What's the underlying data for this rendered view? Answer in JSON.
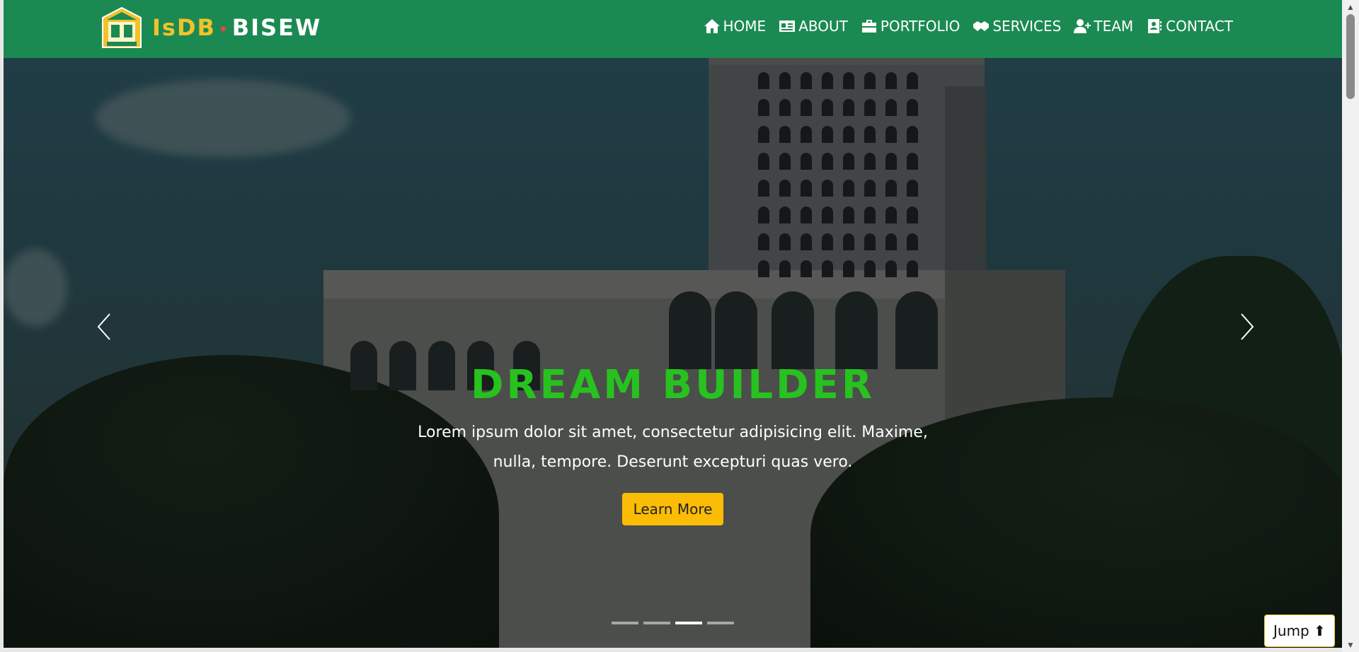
{
  "brand": {
    "part1": "IsDB",
    "dot": "•",
    "part2": "BISEW",
    "logo_text": "IsDB-BISEW"
  },
  "nav": [
    {
      "label": "HOME",
      "icon": "home-icon"
    },
    {
      "label": "ABOUT",
      "icon": "id-card-icon"
    },
    {
      "label": "PORTFOLIO",
      "icon": "briefcase-icon"
    },
    {
      "label": "SERVICES",
      "icon": "handshake-icon"
    },
    {
      "label": "TEAM",
      "icon": "user-plus-icon"
    },
    {
      "label": "CONTACT",
      "icon": "address-book-icon"
    }
  ],
  "hero": {
    "title": "DREAM BUILDER",
    "text": "Lorem ipsum dolor sit amet, consectetur adipisicing elit. Maxime, nulla, tempore. Deserunt excepturi quas vero.",
    "button": "Learn More",
    "slides_total": 4,
    "active_slide": 3
  },
  "jump_button": "Jump ⬆",
  "colors": {
    "navbar": "#1b8a52",
    "brand_accent": "#f2c22a",
    "title": "#27c21f",
    "button": "#fbbc05"
  }
}
